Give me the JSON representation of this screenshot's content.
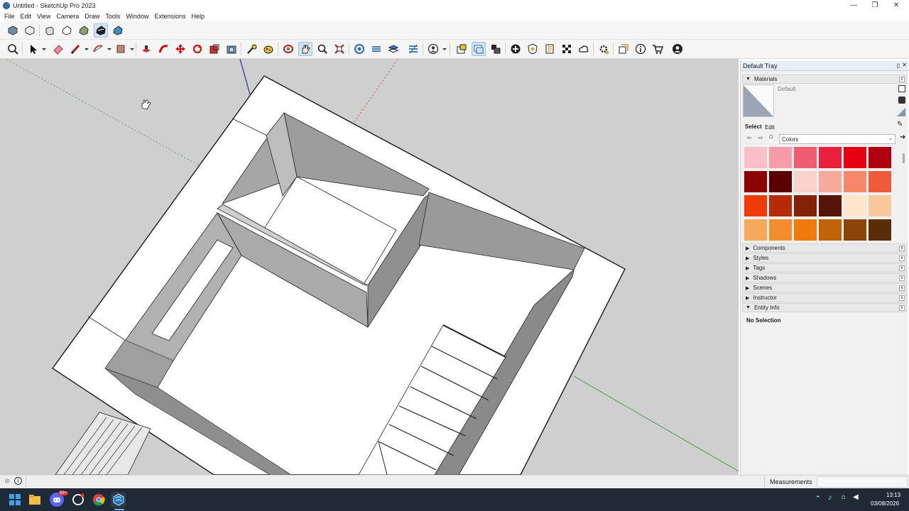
{
  "window": {
    "title": "Untitled - SketchUp Pro 2023",
    "minimize": "—",
    "maximize": "❐",
    "close": "✕"
  },
  "menu": [
    "File",
    "Edit",
    "View",
    "Camera",
    "Draw",
    "Tools",
    "Window",
    "Extensions",
    "Help"
  ],
  "toolbar_top": [
    "iso-view-icon",
    "top-view-icon",
    "front-view-icon",
    "right-view-icon",
    "back-view-icon",
    "left-view-icon",
    "xray-icon"
  ],
  "toolbar_main": [
    "zoom-icon",
    "select-icon",
    "eraser-icon",
    "pencil-icon",
    "arc-icon",
    "rectangle-icon",
    "push-pull-icon",
    "follow-me-icon",
    "move-icon",
    "rotate-icon",
    "scale-icon",
    "offset-icon",
    "tape-measure-icon",
    "paint-bucket-icon",
    "orbit-icon",
    "pan-icon",
    "zoom-window-icon",
    "zoom-extents-icon",
    "section-plane-icon",
    "display-section-icon",
    "section-cuts-icon",
    "section-fill-icon",
    "user-icon",
    "components-icon",
    "materials-tray-icon",
    "outliner-icon",
    "add-location-icon",
    "geo-icon",
    "model-info-icon",
    "texture-icon",
    "cloud-icon",
    "extension-icon",
    "layout-icon",
    "info-icon",
    "warehouse-icon",
    "account-icon"
  ],
  "tray": {
    "title": "Default Tray",
    "materials": {
      "header": "Materials",
      "current": "Default",
      "tab_select": "Select",
      "tab_edit": "Edit",
      "library": "Colors",
      "swatches": [
        "#f9c0c8",
        "#f89ba8",
        "#ee5c72",
        "#e8203c",
        "#e60012",
        "#b0000d",
        "#8b0000",
        "#5a0000",
        "#fad4cc",
        "#f6ab9c",
        "#f5876b",
        "#ef5a3c",
        "#f03a0a",
        "#b72a07",
        "#832106",
        "#561508",
        "#fde6cc",
        "#f9c89b",
        "#f7a95a",
        "#f58c2e",
        "#f07a0b",
        "#c06206",
        "#8a4506",
        "#5a2d06"
      ]
    },
    "panels": [
      "Components",
      "Styles",
      "Tags",
      "Shadows",
      "Scenes",
      "Instructor",
      "Entity Info"
    ],
    "entity_info_text": "No Selection"
  },
  "status": {
    "measurements_label": "Measurements"
  },
  "taskbar": {
    "time": "13:13",
    "date": "03/08/2026",
    "badge": "99+"
  }
}
